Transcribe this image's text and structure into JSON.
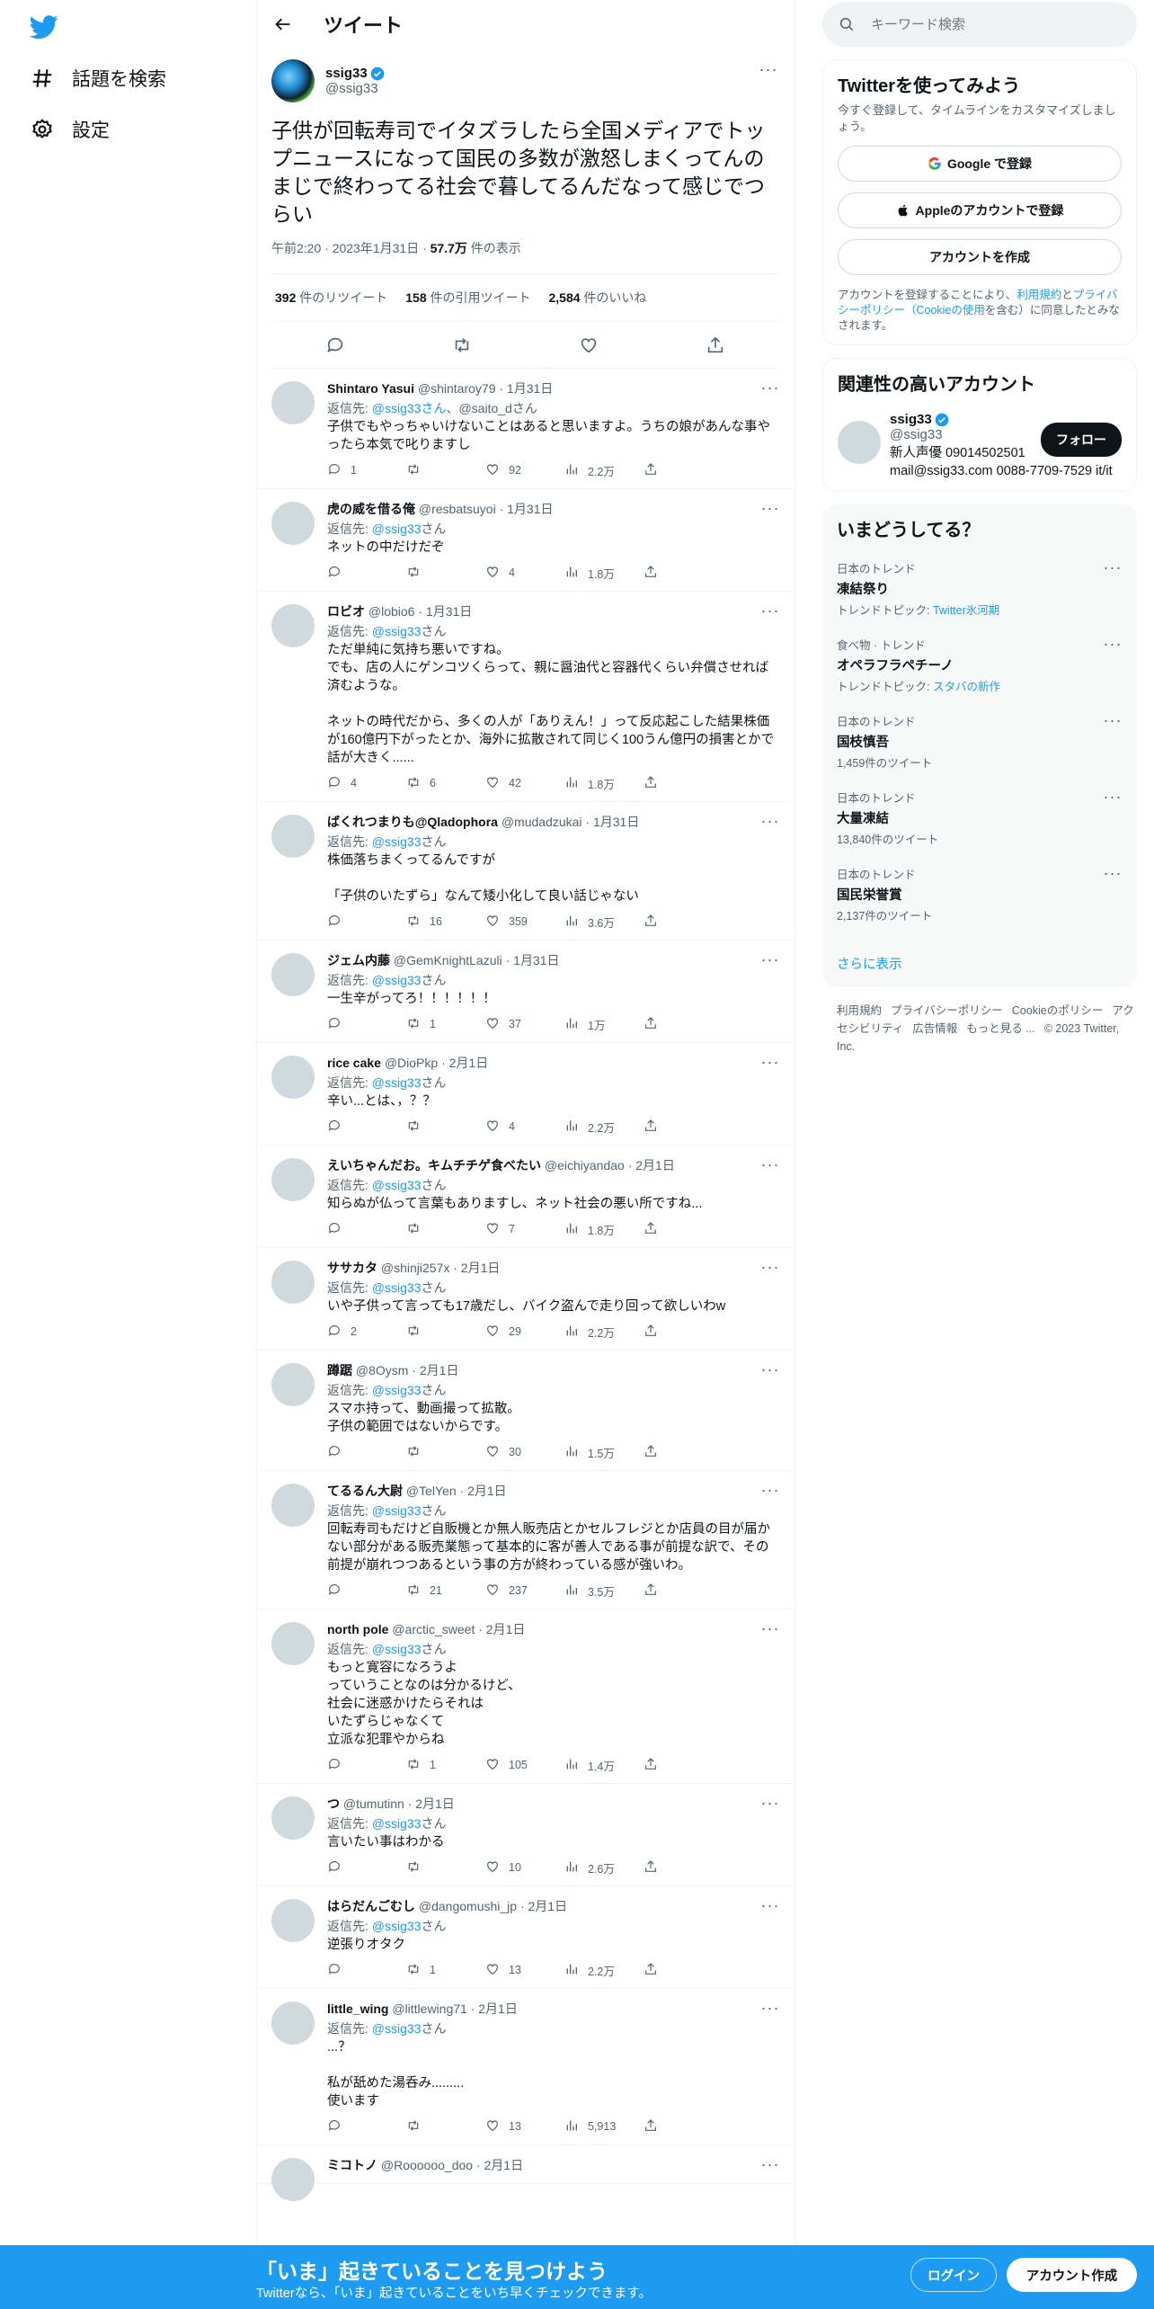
{
  "nav": {
    "explore_label": "話題を検索",
    "settings_label": "設定"
  },
  "header": {
    "title": "ツイート"
  },
  "tweet": {
    "name": "ssig33",
    "handle": "@ssig33",
    "text": "子供が回転寿司でイタズラしたら全国メディアでトップニュースになって国民の多数が激怒しまくってんのまじで終わってる社会で暮してるんだなって感じでつらい",
    "time": "午前2:20 · 2023年1月31日 · ",
    "views_count": "57.7万",
    "views_label": " 件の表示",
    "retweets": "392",
    "retweets_label": " 件のリツイート",
    "quotes": "158",
    "quotes_label": " 件の引用ツイート",
    "likes": "2,584",
    "likes_label": " 件のいいね"
  },
  "replies": [
    {
      "name": "Shintaro Yasui",
      "meta": " @shintaroy79 · 1月31日",
      "to_prefix": "返信先: ",
      "to_mention": "@ssig33さん",
      "to_rest": "、@saito_dさん",
      "text": "子供でもやっちゃいけないことはあると思いますよ。うちの娘があんな事やったら本気で叱りますし",
      "replies": "1",
      "retweets": "",
      "likes": "92",
      "views": "2.2万"
    },
    {
      "name": "虎の威を借る俺",
      "meta": " @resbatsuyoi · 1月31日",
      "to_prefix": "返信先: ",
      "to_mention": "@ssig33",
      "to_rest": "さん",
      "text": "ネットの中だけだぞ",
      "replies": "",
      "retweets": "",
      "likes": "4",
      "views": "1.8万"
    },
    {
      "name": "ロビオ",
      "meta": " @lobio6 · 1月31日",
      "to_prefix": "返信先: ",
      "to_mention": "@ssig33",
      "to_rest": "さん",
      "text": "ただ単純に気持ち悪いですね。\nでも、店の人にゲンコツくらって、親に醤油代と容器代くらい弁償させれば済むような。\n\nネットの時代だから、多くの人が「ありえん！」って反応起こした結果株価が160億円下がったとか、海外に拡散されて同じく100うん億円の損害とかで話が大きく......",
      "replies": "4",
      "retweets": "6",
      "likes": "42",
      "views": "1.8万"
    },
    {
      "name": "ばくれつまりも@Qladophora",
      "meta": " @mudadzukai · 1月31日",
      "to_prefix": "返信先: ",
      "to_mention": "@ssig33",
      "to_rest": "さん",
      "text": "株価落ちまくってるんですが\n\n「子供のいたずら」なんて矮小化して良い話じゃない",
      "replies": "",
      "retweets": "16",
      "likes": "359",
      "views": "3.6万"
    },
    {
      "name": "ジェム内藤",
      "meta": "          @GemKnightLazuli · 1月31日",
      "to_prefix": "返信先: ",
      "to_mention": "@ssig33",
      "to_rest": "さん",
      "text": "一生辛がってろ！！！！！！",
      "replies": "",
      "retweets": "1",
      "likes": "37",
      "views": "1万"
    },
    {
      "name": "rice cake",
      "meta": " @DioPkp · 2月1日",
      "to_prefix": "返信先: ",
      "to_mention": "@ssig33",
      "to_rest": "さん",
      "text": "辛い...とは、，？？",
      "replies": "",
      "retweets": "",
      "likes": "4",
      "views": "2.2万"
    },
    {
      "name": "えいちゃんだお。キムチチゲ食べたい",
      "meta": " @eichiyandao · 2月1日",
      "to_prefix": "返信先: ",
      "to_mention": "@ssig33",
      "to_rest": "さん",
      "text": "知らぬが仏って言葉もありますし、ネット社会の悪い所ですね...",
      "replies": "",
      "retweets": "",
      "likes": "7",
      "views": "1.8万"
    },
    {
      "name": "ササカタ",
      "meta": " @shinji257x · 2月1日",
      "to_prefix": "返信先: ",
      "to_mention": "@ssig33",
      "to_rest": "さん",
      "text": "いや子供って言っても17歳だし、バイク盗んで走り回って欲しいわw",
      "replies": "2",
      "retweets": "",
      "likes": "29",
      "views": "2.2万"
    },
    {
      "name": "蹲踞",
      "meta": " @8Oysm · 2月1日",
      "to_prefix": "返信先: ",
      "to_mention": "@ssig33",
      "to_rest": "さん",
      "text": "スマホ持って、動画撮って拡散。\n子供の範囲ではないからです。",
      "replies": "",
      "retweets": "",
      "likes": "30",
      "views": "1.5万"
    },
    {
      "name": "てるるん大尉",
      "meta": " @TelYen · 2月1日",
      "to_prefix": "返信先: ",
      "to_mention": "@ssig33",
      "to_rest": "さん",
      "text": "回転寿司もだけど自販機とか無人販売店とかセルフレジとか店員の目が届かない部分がある販売業態って基本的に客が善人である事が前提な訳で、その前提が崩れつつあるという事の方が終わっている感が強いわ。",
      "replies": "",
      "retweets": "21",
      "likes": "237",
      "views": "3.5万"
    },
    {
      "name": "north pole",
      "meta": " @arctic_sweet · 2月1日",
      "to_prefix": "返信先: ",
      "to_mention": "@ssig33",
      "to_rest": "さん",
      "text": "もっと寛容になろうよ\nっていうことなのは分かるけど、\n社会に迷惑かけたらそれは\nいたずらじゃなくて\n立派な犯罪やからね",
      "replies": "",
      "retweets": "1",
      "likes": "105",
      "views": "1.4万"
    },
    {
      "name": "つ",
      "meta": " @tumutinn · 2月1日",
      "to_prefix": "返信先: ",
      "to_mention": "@ssig33",
      "to_rest": "さん",
      "text": "言いたい事はわかる",
      "replies": "",
      "retweets": "",
      "likes": "10",
      "views": "2.6万"
    },
    {
      "name": "はらだんごむし",
      "meta": " @dangomushi_jp · 2月1日",
      "to_prefix": "返信先: ",
      "to_mention": "@ssig33",
      "to_rest": "さん",
      "text": "逆張りオタク",
      "replies": "",
      "retweets": "1",
      "likes": "13",
      "views": "2.2万"
    },
    {
      "name": "little_wing",
      "meta": " @littlewing71 · 2月1日",
      "to_prefix": "返信先: ",
      "to_mention": "@ssig33",
      "to_rest": "さん",
      "text": "...？\n\n私が舐めた湯呑み.........\n使います",
      "replies": "",
      "retweets": "",
      "likes": "13",
      "views": "5,913"
    },
    {
      "name": "ミコトノ",
      "meta": " @Roooooo_doo · 2月1日",
      "to_prefix": "",
      "to_mention": "",
      "to_rest": "",
      "text": "",
      "replies": "",
      "retweets": "",
      "likes": "",
      "views": ""
    }
  ],
  "sidebar": {
    "search_placeholder": "キーワード検索",
    "signup": {
      "title": "Twitterを使ってみよう",
      "sub": "今すぐ登録して、タイムラインをカスタマイズしましょう。",
      "google": "Google で登録",
      "apple": "Appleのアカウントで登録",
      "create": "アカウントを作成",
      "legal_1": "アカウントを登録することにより、",
      "legal_terms": "利用規約",
      "legal_2": "と",
      "legal_privacy": "プライバシーポリシー（Cookieの使用",
      "legal_3": "を含む）に同意したとみなされます。"
    },
    "relevant": {
      "title": "関連性の高いアカウント",
      "name": "ssig33",
      "handle": "@ssig33",
      "follow": "フォロー",
      "bio": "新人声優 09014502501\nmail@ssig33.com 0088-7709-7529 it/it"
    },
    "trends": {
      "title": "いまどうしてる？",
      "items": [
        {
          "cat": "日本のトレンド",
          "name": "凍結祭り",
          "extra_prefix": "トレンドトピック: ",
          "extra_link": "Twitter氷河期"
        },
        {
          "cat": "食べ物 · トレンド",
          "name": "オペラフラペチーノ",
          "extra_prefix": "トレンドトピック: ",
          "extra_link": "スタバの新作"
        },
        {
          "cat": "日本のトレンド",
          "name": "国枝慎吾",
          "extra_prefix": "1,459件のツイート",
          "extra_link": ""
        },
        {
          "cat": "日本のトレンド",
          "name": "大量凍結",
          "extra_prefix": "13,840件のツイート",
          "extra_link": ""
        },
        {
          "cat": "日本のトレンド",
          "name": "国民栄誉賞",
          "extra_prefix": "2,137件のツイート",
          "extra_link": ""
        }
      ],
      "show_more": "さらに表示"
    },
    "footer": [
      "利用規約",
      "プライバシーポリシー",
      "Cookieのポリシー",
      "アクセシビリティ",
      "広告情報",
      "もっと見る ...",
      "© 2023 Twitter, Inc."
    ]
  },
  "banner": {
    "title": "「いま」起きていることを見つけよう",
    "sub": "Twitterなら、「いま」起きていることをいち早くチェックできます。",
    "login": "ログイン",
    "signup": "アカウント作成"
  },
  "colors": {
    "accent": "#1d9bf0",
    "text": "#0f1419",
    "muted": "#536471"
  }
}
